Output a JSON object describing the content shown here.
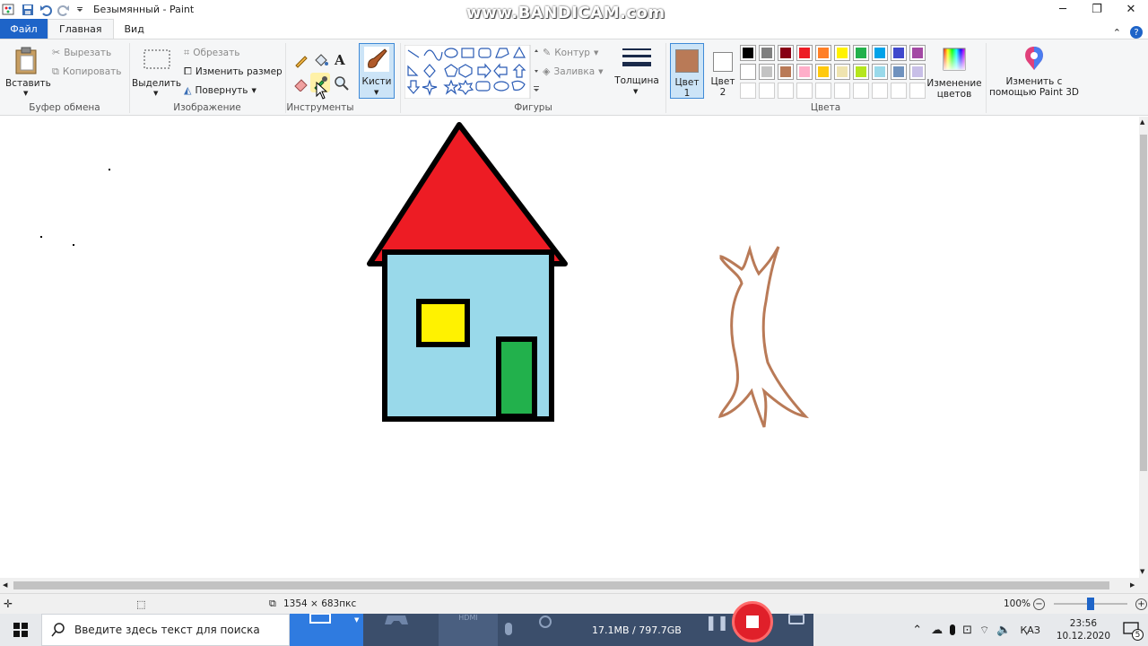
{
  "window": {
    "title": "Безымянный - Paint",
    "watermark": "www.BANDICAM.com"
  },
  "tabs": [
    "Файл",
    "Главная",
    "Вид"
  ],
  "clipboard": {
    "paste_label": "Вставить",
    "cut_label": "Вырезать",
    "copy_label": "Копировать",
    "group_label": "Буфер обмена"
  },
  "image": {
    "select_label": "Выделить",
    "crop_label": "Обрезать",
    "resize_label": "Изменить размер",
    "rotate_label": "Повернуть",
    "group_label": "Изображение"
  },
  "tools": {
    "group_label": "Инструменты",
    "brushes_label": "Кисти"
  },
  "shapes": {
    "group_label": "Фигуры",
    "outline_label": "Контур",
    "fill_label": "Заливка"
  },
  "size": {
    "label": "Толщина"
  },
  "colors": {
    "color1_label": "Цвет",
    "color1_num": "1",
    "color2_label": "Цвет",
    "color2_num": "2",
    "color1_value": "#b97a57",
    "color2_value": "#ffffff",
    "edit_label": "Изменение цветов",
    "group_label": "Цвета",
    "palette_row1": [
      "#000000",
      "#7f7f7f",
      "#880015",
      "#ed1c24",
      "#ff7f27",
      "#fff200",
      "#22b14c",
      "#00a2e8",
      "#3f48cc",
      "#a349a4"
    ],
    "palette_row2": [
      "#ffffff",
      "#c3c3c3",
      "#b97a57",
      "#ffaec9",
      "#ffc90e",
      "#efe4b0",
      "#b5e61d",
      "#99d9ea",
      "#7092be",
      "#c8bfe7"
    ]
  },
  "paint3d": {
    "label": "Изменить с помощью Paint 3D"
  },
  "drawing": {
    "roof_color": "#ed1c24",
    "wall_color": "#99d9ea",
    "window_color": "#fff200",
    "door_color": "#22b14c",
    "trunk_color": "#b97a57"
  },
  "status": {
    "canvas_size": "1354 × 683пкс",
    "zoom": "100%"
  },
  "taskbar": {
    "search_placeholder": "Введите здесь текст для поиска",
    "rec_size": "17.1MB / 797.7GB",
    "lang": "ҚАЗ",
    "time": "23:56",
    "date": "10.12.2020",
    "notifications": "5"
  }
}
